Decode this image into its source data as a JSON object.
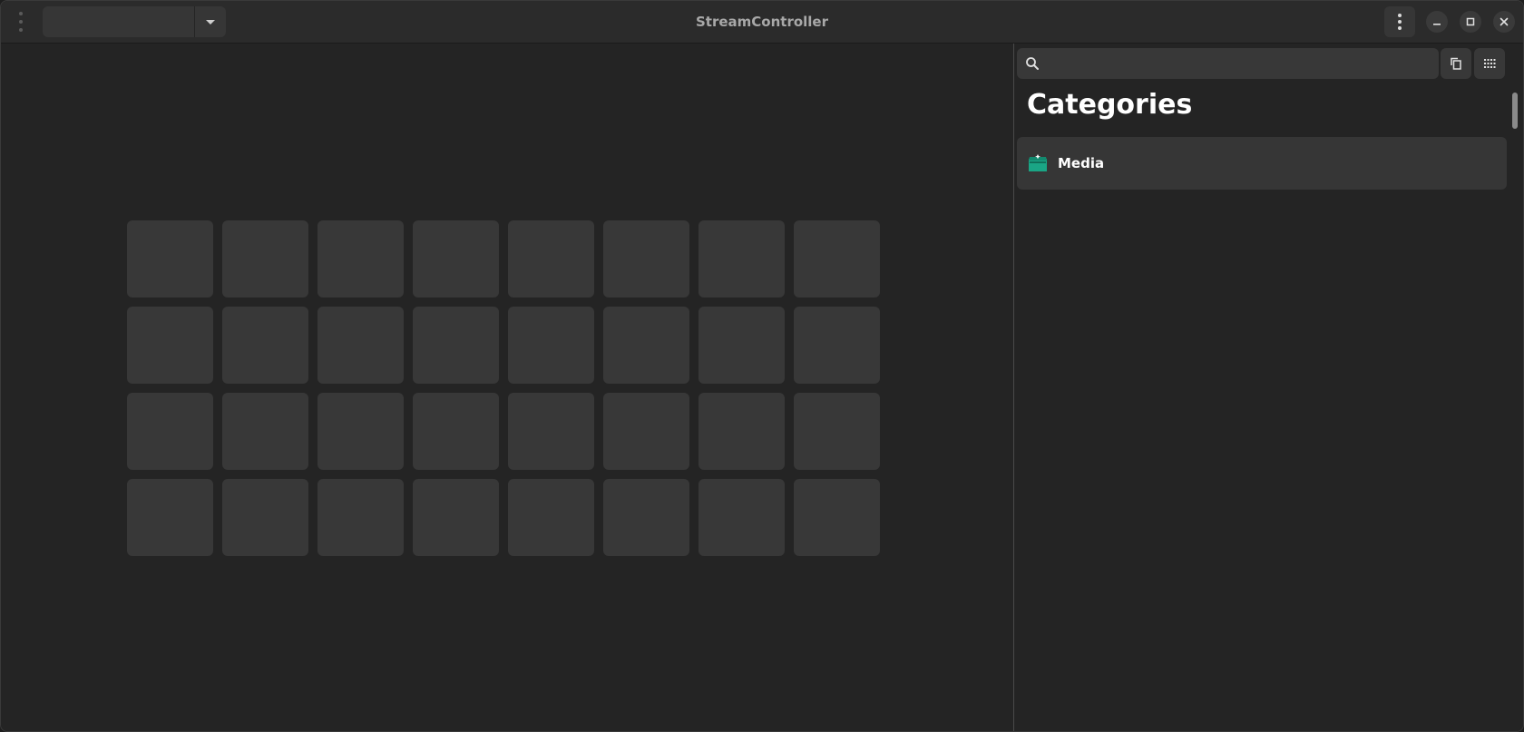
{
  "window": {
    "title": "StreamController"
  },
  "header": {
    "deck_selector": {
      "value": ""
    }
  },
  "deck": {
    "rows": 4,
    "columns": 8
  },
  "sidebar": {
    "search": {
      "value": "",
      "placeholder": ""
    },
    "categories_title": "Categories",
    "categories": [
      {
        "label": "Media",
        "icon": "media-store-icon",
        "icon_color": "#1aa585"
      }
    ]
  },
  "colors": {
    "window_bg": "#242424",
    "header_bg": "#2b2b2b",
    "key_bg": "#383838",
    "accent_teal": "#1aa585"
  }
}
